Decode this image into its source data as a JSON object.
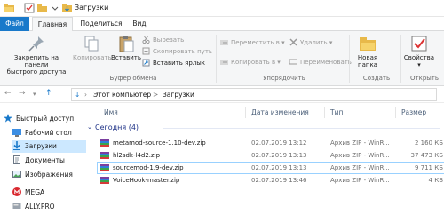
{
  "window": {
    "title": "Загрузки"
  },
  "ribbon_tabs": {
    "file": "Файл",
    "home": "Главная",
    "share": "Поделиться",
    "view": "Вид"
  },
  "ribbon": {
    "pin_label": "Закрепить на панели быстрого доступа",
    "pin_line1": "Закрепить на панели",
    "pin_line2": "быстрого доступа",
    "copy": "Копировать",
    "paste": "Вставить",
    "cut": "Вырезать",
    "copy_path": "Скопировать путь",
    "paste_shortcut": "Вставить ярлык",
    "clipboard_group": "Буфер обмена",
    "move_to": "Переместить в",
    "copy_to": "Копировать в",
    "delete": "Удалить",
    "rename": "Переименовать",
    "organize_group": "Упорядочить",
    "new_folder_line1": "Новая",
    "new_folder_line2": "папка",
    "create_group": "Создать",
    "properties": "Свойства",
    "open_group": "Открыть"
  },
  "address": {
    "crumbs": [
      "Этот компьютер",
      "Загрузки"
    ],
    "separator": ">"
  },
  "navpane": {
    "items": [
      {
        "label": "Быстрый доступ",
        "icon": "star-icon"
      },
      {
        "label": "Рабочий стол",
        "icon": "desktop-folder-icon"
      },
      {
        "label": "Загрузки",
        "icon": "download-folder-icon"
      },
      {
        "label": "Документы",
        "icon": "documents-icon"
      },
      {
        "label": "Изображения",
        "icon": "pictures-icon"
      },
      {
        "label": "MEGA",
        "icon": "mega-icon"
      },
      {
        "label": "ALLY.PRO",
        "icon": "drive-icon"
      }
    ]
  },
  "filelist": {
    "columns": {
      "name": "Имя",
      "date": "Дата изменения",
      "type": "Тип",
      "size": "Размер"
    },
    "group": "Сегодня (4)",
    "rows": [
      {
        "name": "metamod-source-1.10-dev.zip",
        "date": "02.07.2019 13:12",
        "type": "Архив ZIP - WinR...",
        "size": "2 160 КБ"
      },
      {
        "name": "hl2sdk-l4d2.zip",
        "date": "02.07.2019 13:13",
        "type": "Архив ZIP - WinR...",
        "size": "37 473 КБ"
      },
      {
        "name": "sourcemod-1.9-dev.zip",
        "date": "02.07.2019 13:13",
        "type": "Архив ZIP - WinR...",
        "size": "9 711 КБ"
      },
      {
        "name": "VoiceHook-master.zip",
        "date": "02.07.2019 13:46",
        "type": "Архив ZIP - WinR...",
        "size": "4 КБ"
      }
    ]
  },
  "colors": {
    "accent": "#1979ca",
    "selection": "#cce8ff",
    "group_text": "#1e3287"
  }
}
